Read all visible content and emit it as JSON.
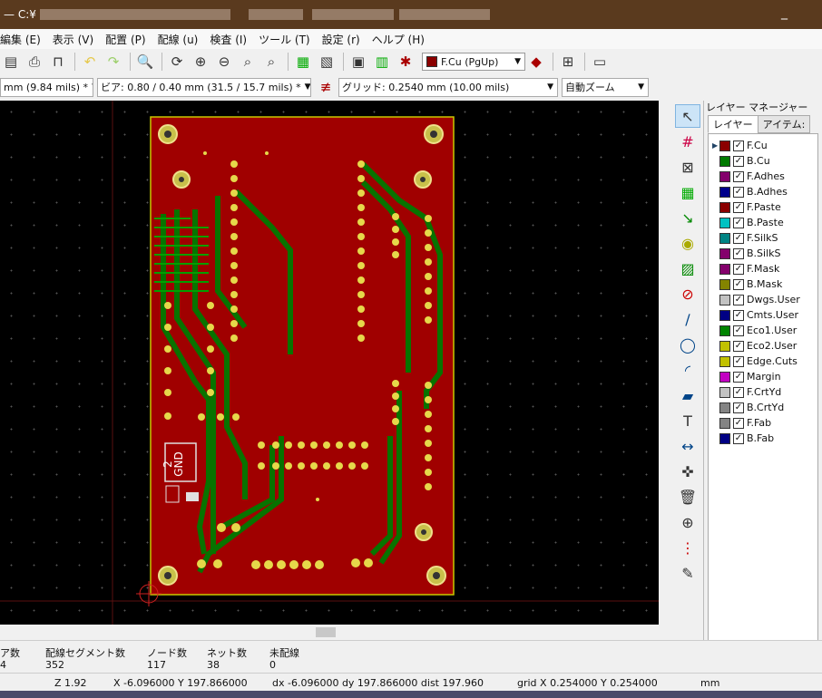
{
  "window": {
    "title": "— C:¥",
    "minimize": "_"
  },
  "menu": [
    "編集 (E)",
    "表示 (V)",
    "配置 (P)",
    "配線 (u)",
    "検査 (I)",
    "ツール (T)",
    "設定 (r)",
    "ヘルプ (H)"
  ],
  "toolbar": {
    "layer_select": "F.Cu (PgUp)",
    "layer_color": "#8b0000"
  },
  "toolbar2": {
    "track_width": "mm (9.84 mils) *",
    "via_size": "ビア: 0.80 / 0.40 mm (31.5 / 15.7 mils) *",
    "grid": "グリッド: 0.2540 mm (10.00 mils)",
    "zoom": "自動ズーム"
  },
  "board_text": {
    "label2": "2",
    "gnd": "GND"
  },
  "layer_manager": {
    "title": "レイヤー マネージャー",
    "tabs": [
      "レイヤー",
      "アイテム:"
    ],
    "layers": [
      {
        "name": "F.Cu",
        "color": "#8b0000"
      },
      {
        "name": "B.Cu",
        "color": "#007a00"
      },
      {
        "name": "F.Adhes",
        "color": "#84006c"
      },
      {
        "name": "B.Adhes",
        "color": "#00008b"
      },
      {
        "name": "F.Paste",
        "color": "#8b0000"
      },
      {
        "name": "B.Paste",
        "color": "#00c2c2"
      },
      {
        "name": "F.SilkS",
        "color": "#008484"
      },
      {
        "name": "B.SilkS",
        "color": "#84006c"
      },
      {
        "name": "F.Mask",
        "color": "#84006c"
      },
      {
        "name": "B.Mask",
        "color": "#848400"
      },
      {
        "name": "Dwgs.User",
        "color": "#c2c2c2"
      },
      {
        "name": "Cmts.User",
        "color": "#000084"
      },
      {
        "name": "Eco1.User",
        "color": "#008400"
      },
      {
        "name": "Eco2.User",
        "color": "#c2c200"
      },
      {
        "name": "Edge.Cuts",
        "color": "#c2c200"
      },
      {
        "name": "Margin",
        "color": "#c200c2"
      },
      {
        "name": "F.CrtYd",
        "color": "#c2c2c2"
      },
      {
        "name": "B.CrtYd",
        "color": "#848484"
      },
      {
        "name": "F.Fab",
        "color": "#848484"
      },
      {
        "name": "B.Fab",
        "color": "#000084"
      }
    ]
  },
  "status": {
    "headers": [
      "ア数",
      "配線セグメント数",
      "ノード数",
      "ネット数",
      "未配線"
    ],
    "values": [
      "4",
      "352",
      "117",
      "38",
      "0"
    ],
    "zoom": "Z 1.92",
    "xy": "X -6.096000  Y 197.866000",
    "delta": "dx -6.096000  dy 197.866000  dist 197.960",
    "gridinfo": "grid X 0.254000  Y 0.254000",
    "units": "mm"
  }
}
